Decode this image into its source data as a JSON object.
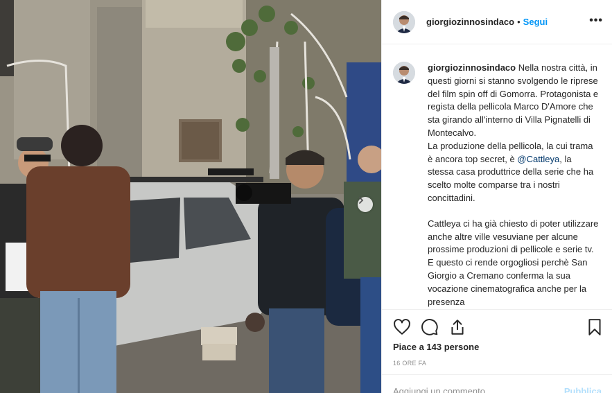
{
  "post": {
    "username": "giorgiozinnosindaco",
    "follow_label": "Segui",
    "separator": "•",
    "more_label": "•••",
    "caption_lines": [
      "Nella nostra città, in questi giorni si stanno svolgendo le riprese del film spin off di Gomorra. Protagonista e regista della pellicola Marco D'Amore che sta girando all'interno di Villa Pignatelli di Montecalvo.",
      "La produzione della pellicola, la cui trama è ancora top secret, è",
      "@Cattleya",
      ", la stessa casa produttrice della serie che ha scelto molte comparse tra i nostri concittadini.",
      "Cattleya ci ha già chiesto di poter utilizzare anche altre ville vesuviane per alcune prossime produzioni di pellicole e serie tv. E questo ci rende orgogliosi perchè San Giorgio a Cremano conferma la sua vocazione cinematografica anche per la presenza"
    ],
    "likes_text": "Piace a 143 persone",
    "timestamp": "16 ORE FA",
    "comment_placeholder": "Aggiungi un commento...",
    "publish_label": "Pubblica"
  },
  "icons": {
    "like": "heart-icon",
    "comment": "comment-bubble-icon",
    "share": "share-icon",
    "save": "bookmark-icon",
    "next": "chevron-right-icon"
  },
  "colors": {
    "follow": "#0095f6",
    "mention": "#00376b",
    "muted": "#8e8e8e",
    "border": "#efefef"
  }
}
